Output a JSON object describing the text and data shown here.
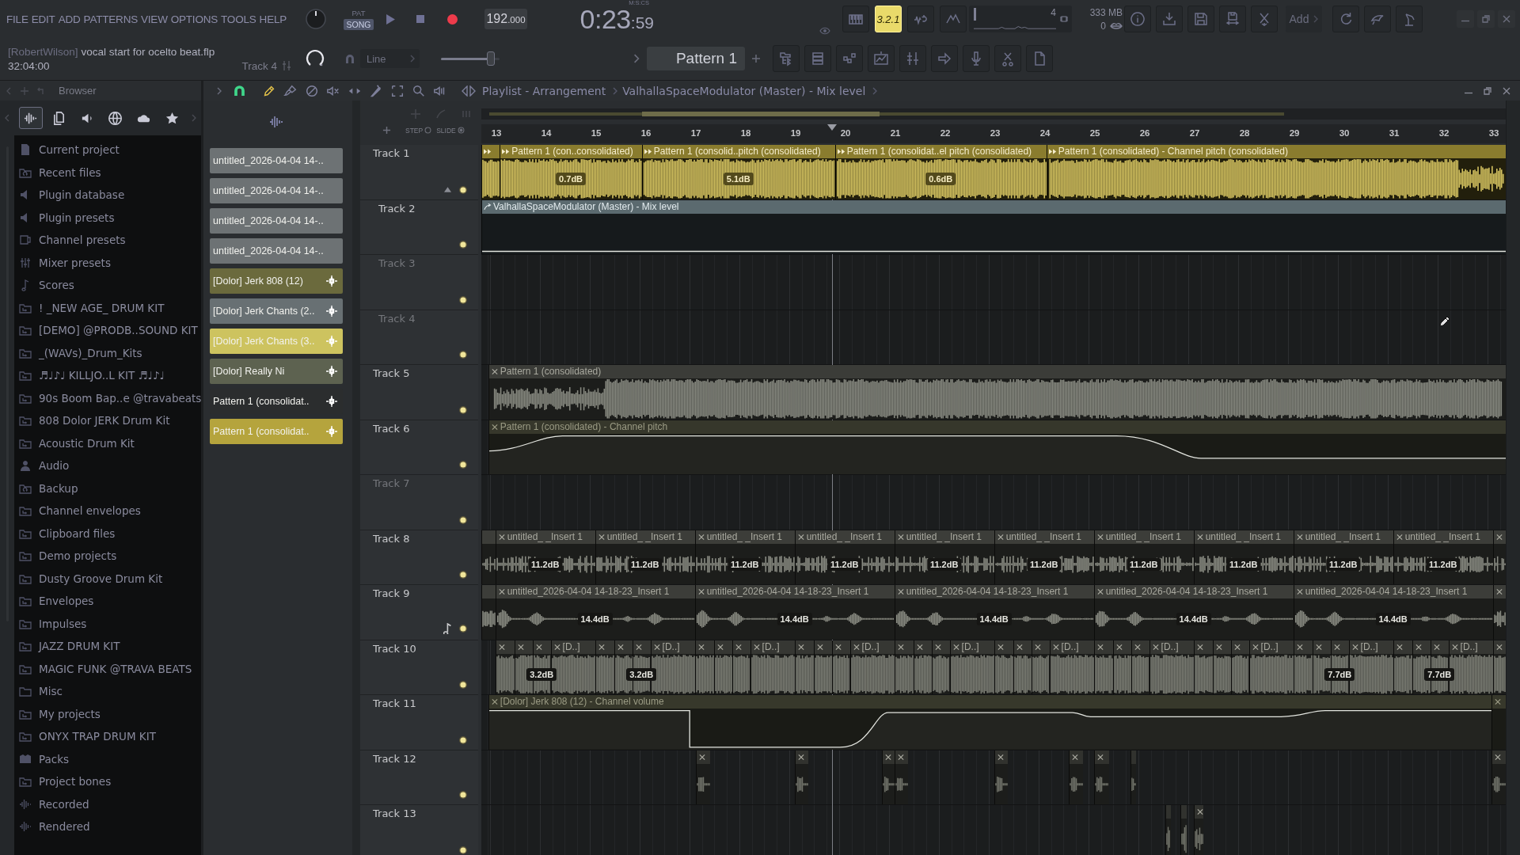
{
  "menu_bar": [
    "FILE",
    "EDIT",
    "ADD",
    "PATTERNS",
    "VIEW",
    "OPTIONS",
    "TOOLS",
    "HELP"
  ],
  "project": {
    "author": "[RobertWilson]",
    "file_name": "vocal start for ocelto beat.flp",
    "position": "32:04:00",
    "target": "Track 4"
  },
  "transport": {
    "modes": [
      {
        "label": "PAT",
        "selected": false
      },
      {
        "label": "SONG",
        "selected": true
      }
    ],
    "tempo": "192",
    "tempo_fraction": ".000",
    "time_label": "M:S:CS",
    "time": "0:23",
    "time_fraction": ":59"
  },
  "countdown": {
    "label": "3.2.1",
    "on": true
  },
  "meters": {
    "cpu": "4",
    "memory": "333 MB",
    "polyphony": "0"
  },
  "add_menu": {
    "label": "Add"
  },
  "snap": {
    "value": "Line"
  },
  "slider": {
    "level": 0.85
  },
  "pattern_selector": {
    "value": "Pattern 1"
  },
  "browser": {
    "title": "Browser",
    "tabs": [
      {
        "kind": "all",
        "selected": true
      },
      {
        "kind": "projects",
        "selected": false
      },
      {
        "kind": "plugins",
        "selected": false
      },
      {
        "kind": "online",
        "selected": false
      },
      {
        "kind": "cloud",
        "selected": false
      },
      {
        "kind": "favorites",
        "selected": false
      }
    ],
    "items": [
      {
        "label": "Current project",
        "kind": "project"
      },
      {
        "label": "Recent files",
        "kind": "recent"
      },
      {
        "label": "Plugin database",
        "kind": "plugins"
      },
      {
        "label": "Plugin presets",
        "kind": "plugins"
      },
      {
        "label": "Channel presets",
        "kind": "channel"
      },
      {
        "label": "Mixer presets",
        "kind": "mixer"
      },
      {
        "label": "Scores",
        "kind": "score"
      },
      {
        "label": "! _NEW AGE_ DRUM KIT",
        "kind": "linked"
      },
      {
        "label": "[DEMO] @PRODB..SOUND KIT",
        "kind": "linked"
      },
      {
        "label": "_(WAVs)_Drum_Kits",
        "kind": "linked"
      },
      {
        "label": "♬♩♪♩ KILLJO..L KIT ♬♩♪♩",
        "kind": "linked"
      },
      {
        "label": "90s Boom Bap..e @travabeats",
        "kind": "linked"
      },
      {
        "label": "808 Dolor JERK Drum Kit",
        "kind": "linked"
      },
      {
        "label": "Acoustic Drum Kit",
        "kind": "linked"
      },
      {
        "label": "Audio",
        "kind": "user"
      },
      {
        "label": "Backup",
        "kind": "recent"
      },
      {
        "label": "Channel envelopes",
        "kind": "linked"
      },
      {
        "label": "Clipboard files",
        "kind": "linked"
      },
      {
        "label": "Demo projects",
        "kind": "linked"
      },
      {
        "label": "Dusty Groove Drum Kit",
        "kind": "linked"
      },
      {
        "label": "Envelopes",
        "kind": "linked"
      },
      {
        "label": "Impulses",
        "kind": "linked"
      },
      {
        "label": "JAZZ DRUM KIT",
        "kind": "linked"
      },
      {
        "label": "MAGIC FUNK @TRAVA BEATS",
        "kind": "linked"
      },
      {
        "label": "Misc",
        "kind": "folder"
      },
      {
        "label": "My projects",
        "kind": "linked"
      },
      {
        "label": "ONYX TRAP DRUM KIT",
        "kind": "linked"
      },
      {
        "label": "Packs",
        "kind": "packs"
      },
      {
        "label": "Project bones",
        "kind": "linked"
      },
      {
        "label": "Recorded",
        "kind": "recorded"
      },
      {
        "label": "Rendered",
        "kind": "recorded"
      }
    ]
  },
  "playlist": {
    "title": "Playlist - Arrangement",
    "breadcrumb": "ValhallaSpaceModulator (Master) - Mix level",
    "snap_on": true,
    "tools": [
      {
        "kind": "draw",
        "selected": true
      },
      {
        "kind": "paint",
        "selected": false
      },
      {
        "kind": "delete",
        "selected": false
      },
      {
        "kind": "mute",
        "selected": false
      },
      {
        "kind": "slip",
        "selected": false
      },
      {
        "kind": "slice",
        "selected": false
      },
      {
        "kind": "select",
        "selected": false
      },
      {
        "kind": "zoom",
        "selected": false
      },
      {
        "kind": "playback",
        "selected": false
      }
    ],
    "step_label": "STEP",
    "slide_label": "SLIDE",
    "clip_sources": [
      {
        "label": "untitled_2026-04-04 14-..",
        "kind": "recording",
        "color": "#6d7274"
      },
      {
        "label": "untitled_2026-04-04 14-..",
        "kind": "recording",
        "color": "#6d7274"
      },
      {
        "label": "untitled_2026-04-04 14-..",
        "kind": "recording",
        "color": "#6d7274"
      },
      {
        "label": "untitled_2026-04-04 14-..",
        "kind": "recording",
        "color": "#6d7274"
      },
      {
        "label": "[Dolor] Jerk 808 (12)",
        "kind": "sample",
        "color": "#6b6a3d"
      },
      {
        "label": "[Dolor] Jerk Chants (2..",
        "kind": "sample",
        "color": "#687073"
      },
      {
        "label": "[Dolor] Jerk Chants (3..",
        "kind": "sample",
        "color": "#cdc35f"
      },
      {
        "label": "[Dolor] Really Ni",
        "kind": "sample",
        "color": "#5d6250"
      },
      {
        "label": "Pattern 1 (consolidat..",
        "kind": "sample",
        "color": "#2b2d2e"
      },
      {
        "label": "Pattern 1 (consolidat..",
        "kind": "sample",
        "color": "#b5a43d"
      }
    ],
    "ruler": [
      "13",
      "14",
      "15",
      "16",
      "17",
      "18",
      "19",
      "20",
      "21",
      "22",
      "23",
      "24",
      "25",
      "26",
      "27",
      "28",
      "29",
      "30",
      "31",
      "32",
      "33"
    ],
    "tracks": [
      {
        "name": "Track 1",
        "kind": "pattern",
        "color": "#8a7c2e",
        "on": true,
        "note_marker": false,
        "clips": [
          {
            "selected": false
          },
          {
            "title": "Pattern 1 (con..consolidated)",
            "gain": "0.7dB",
            "selected": false
          },
          {
            "title": "Pattern 1 (consolid..pitch (consolidated)",
            "gain": "5.1dB",
            "selected": false
          },
          {
            "title": "Pattern 1 (consolidat..el pitch (consolidated)",
            "gain": "0.6dB",
            "selected": false
          },
          {
            "title": "Pattern 1 (consolidated) - Channel pitch (consolidated)",
            "selected": false
          }
        ],
        "children": [
          {
            "name": "Track 2",
            "kind": "automation",
            "color": "#5b6a6f",
            "on": true,
            "note_marker": false,
            "clips": [
              {
                "title": "ValhallaSpaceModulator (Master) - Mix level",
                "selected": false
              }
            ]
          },
          {
            "name": "Track 3",
            "kind": "empty",
            "on": true,
            "note_marker": false
          },
          {
            "name": "Track 4",
            "kind": "empty",
            "on": true,
            "note_marker": false
          }
        ]
      },
      {
        "name": "Track 5",
        "kind": "audio",
        "color": "#3b3c38",
        "on": true,
        "note_marker": false,
        "clips": [
          {
            "title": "Pattern 1 (consolidated)",
            "selected": false
          }
        ]
      },
      {
        "name": "Track 6",
        "kind": "envelope",
        "color": "#36372b",
        "on": true,
        "note_marker": false,
        "clips": [
          {
            "title": "Pattern 1 (consolidated) - Channel pitch",
            "selected": false
          }
        ]
      },
      {
        "name": "Track 7",
        "kind": "empty",
        "on": true,
        "note_marker": false
      },
      {
        "name": "Track 8",
        "kind": "audio",
        "color": "#3c3d39",
        "on": true,
        "note_marker": false,
        "clips": [
          {
            "selected": false
          },
          {
            "title": "untitled_ _Insert 1",
            "gain": "11.2dB",
            "selected": false
          },
          {
            "title": "untitled_ _Insert 1",
            "gain": "11.2dB",
            "selected": false
          },
          {
            "title": "untitled_ _Insert 1",
            "gain": "11.2dB",
            "selected": false
          },
          {
            "title": "untitled_ _Insert 1",
            "gain": "11.2dB",
            "selected": false
          },
          {
            "title": "untitled_ _Insert 1",
            "gain": "11.2dB",
            "selected": false
          },
          {
            "title": "untitled_ _Insert 1",
            "gain": "11.2dB",
            "selected": false
          },
          {
            "title": "untitled_ _Insert 1",
            "gain": "11.2dB",
            "selected": false
          },
          {
            "title": "untitled_ _Insert 1",
            "gain": "11.2dB",
            "selected": false
          },
          {
            "title": "untitled_ _Insert 1",
            "gain": "11.2dB",
            "selected": false
          },
          {
            "title": "untitled_ _Insert 1",
            "gain": "11.2dB",
            "selected": false
          },
          {
            "selected": false
          }
        ]
      },
      {
        "name": "Track 9",
        "kind": "audio",
        "color": "#3c3d39",
        "on": true,
        "note_marker": true,
        "clips": [
          {
            "selected": false
          },
          {
            "title": "untitled_2026-04-04 14-18-23_Insert 1",
            "gain": "14.4dB",
            "selected": false
          },
          {
            "title": "untitled_2026-04-04 14-18-23_Insert 1",
            "gain": "14.4dB",
            "selected": false
          },
          {
            "title": "untitled_2026-04-04 14-18-23_Insert 1",
            "gain": "14.4dB",
            "selected": false
          },
          {
            "title": "untitled_2026-04-04 14-18-23_Insert 1",
            "gain": "14.4dB",
            "selected": false
          },
          {
            "title": "untitled_2026-04-04 14-18-23_Insert 1",
            "gain": "14.4dB",
            "selected": false
          },
          {
            "selected": false
          }
        ]
      },
      {
        "name": "Track 10",
        "kind": "audio",
        "color": "#363733",
        "on": true,
        "note_marker": false,
        "clips": [
          {
            "selected": false
          },
          {
            "selected": false
          },
          {
            "gain": "3.2dB",
            "selected": false
          },
          {
            "title": "[D..]",
            "selected": false
          },
          {
            "selected": false
          },
          {
            "selected": false
          },
          {
            "gain": "3.2dB",
            "selected": false
          },
          {
            "title": "[D..]",
            "selected": false
          },
          {
            "selected": false
          },
          {
            "selected": false
          },
          {
            "selected": false
          },
          {
            "title": "[D..]",
            "selected": false
          },
          {
            "selected": false
          },
          {
            "selected": false
          },
          {
            "selected": false
          },
          {
            "title": "[D..]",
            "selected": false
          },
          {
            "selected": false
          },
          {
            "selected": false
          },
          {
            "selected": false
          },
          {
            "title": "[D..]",
            "selected": false
          },
          {
            "selected": false
          },
          {
            "selected": false
          },
          {
            "selected": false
          },
          {
            "title": "[D..]",
            "selected": false
          },
          {
            "selected": false
          },
          {
            "selected": false
          },
          {
            "selected": false
          },
          {
            "title": "[D..]",
            "selected": false
          },
          {
            "selected": false
          },
          {
            "selected": false
          },
          {
            "selected": false
          },
          {
            "title": "[D..]",
            "selected": false
          },
          {
            "selected": false
          },
          {
            "selected": false
          },
          {
            "gain": "7.7dB",
            "selected": false
          },
          {
            "title": "[D..]",
            "selected": false
          },
          {
            "selected": false
          },
          {
            "selected": false
          },
          {
            "gain": "7.7dB",
            "selected": false
          },
          {
            "title": "[D..]",
            "selected": false
          },
          {
            "selected": false
          }
        ]
      },
      {
        "name": "Track 11",
        "kind": "envelope",
        "color": "#37382b",
        "on": true,
        "note_marker": false,
        "clips": [
          {
            "title": "[Dolor] Jerk 808 (12) - Channel volume",
            "selected": false
          },
          {
            "selected": false
          }
        ]
      },
      {
        "name": "Track 12",
        "kind": "audio",
        "color": "#31322e",
        "on": true,
        "note_marker": false,
        "clips": [
          {
            "selected": false
          },
          {
            "selected": false
          },
          {
            "selected": false
          },
          {
            "selected": false
          },
          {
            "selected": false
          },
          {
            "selected": false
          },
          {
            "selected": false
          },
          {
            "selected": false
          },
          {
            "selected": false
          }
        ]
      },
      {
        "name": "Track 13",
        "kind": "audio",
        "color": "#31322e",
        "on": true,
        "note_marker": false,
        "clips": [
          {
            "selected": false
          },
          {
            "selected": false
          },
          {
            "selected": false
          }
        ]
      }
    ]
  }
}
